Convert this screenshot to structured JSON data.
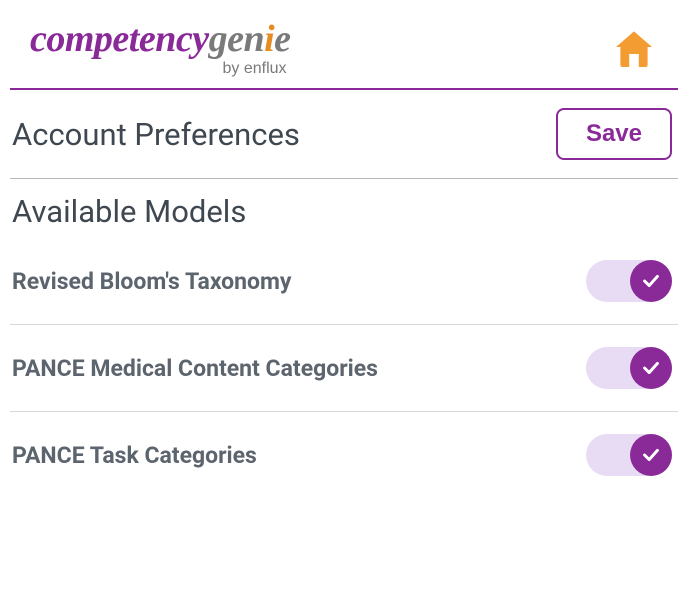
{
  "brand": {
    "part1": "competency",
    "part2": "gen",
    "part3": "i",
    "part4": "e",
    "tagline": "by enflux"
  },
  "prefs": {
    "title": "Account Preferences",
    "save_label": "Save"
  },
  "section": {
    "title": "Available Models"
  },
  "models": [
    {
      "label": "Revised Bloom's Taxonomy",
      "enabled": true
    },
    {
      "label": "PANCE Medical Content Categories",
      "enabled": true
    },
    {
      "label": "PANCE Task Categories",
      "enabled": true
    }
  ],
  "colors": {
    "brand_purple": "#8a2a99",
    "brand_orange": "#f39c32",
    "brand_gray": "#7a7a7a",
    "toggle_track": "#e8dbf4"
  }
}
